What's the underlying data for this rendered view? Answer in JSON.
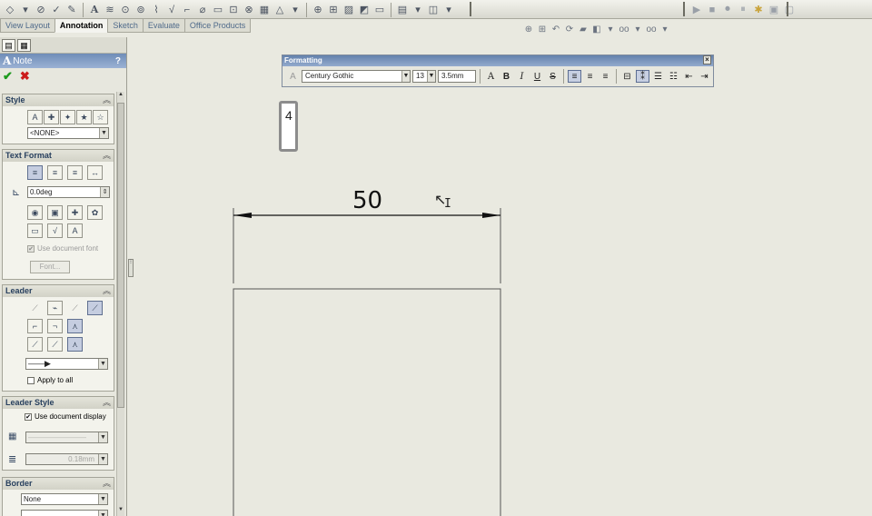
{
  "tabs": [
    "View Layout",
    "Annotation",
    "Sketch",
    "Evaluate",
    "Office Products"
  ],
  "active_tab": "Annotation",
  "property_manager": {
    "title": "Note",
    "help": "?",
    "sections": {
      "style": {
        "title": "Style",
        "selected": "<NONE>"
      },
      "text_format": {
        "title": "Text Format",
        "angle": "0.0deg",
        "use_document_font": "Use document font",
        "font_button": "Font..."
      },
      "leader": {
        "title": "Leader",
        "apply_to_all": "Apply to all"
      },
      "leader_style": {
        "title": "Leader Style",
        "use_document_display": "Use document display",
        "thickness": "0.18mm"
      },
      "border": {
        "title": "Border",
        "selected": "None"
      }
    }
  },
  "formatting_toolbar": {
    "title": "Formatting",
    "font": "Century Gothic",
    "size": "13",
    "height": "3.5mm"
  },
  "drawing": {
    "note_text": "4",
    "dimension_text": "50"
  },
  "colors": {
    "canvas": "#e9e9e0",
    "title_bar": "#6f8db8",
    "ok": "#1d9a1d",
    "cancel": "#cc1b1b"
  }
}
